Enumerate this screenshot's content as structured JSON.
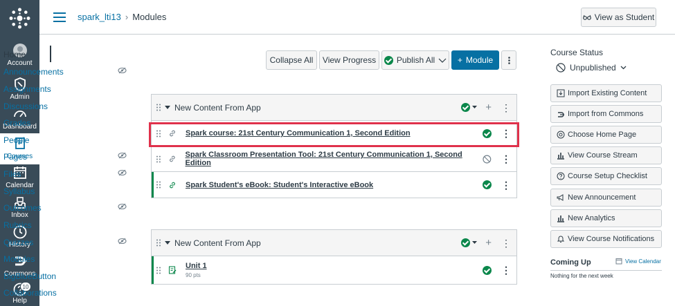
{
  "global_nav": {
    "items": [
      {
        "label": "Account",
        "icon": "account-icon"
      },
      {
        "label": "Admin",
        "icon": "admin-shield-icon"
      },
      {
        "label": "Dashboard",
        "icon": "dashboard-icon"
      },
      {
        "label": "Courses",
        "icon": "courses-book-icon"
      },
      {
        "label": "Calendar",
        "icon": "calendar-icon"
      },
      {
        "label": "Inbox",
        "icon": "inbox-icon"
      },
      {
        "label": "History",
        "icon": "history-clock-icon"
      },
      {
        "label": "Commons",
        "icon": "commons-icon"
      },
      {
        "label": "Help",
        "icon": "help-icon"
      }
    ],
    "help_badge": "10",
    "colors": {
      "bg": "#394b58",
      "active": "#0770a3"
    }
  },
  "header": {
    "course": "spark_lti13",
    "page": "Modules",
    "separator": "›",
    "view_as_student": "View as Student"
  },
  "course_nav": {
    "items": [
      {
        "label": "Home"
      },
      {
        "label": "Announcements"
      },
      {
        "label": "Assignments"
      },
      {
        "label": "Discussions"
      },
      {
        "label": "Grades"
      },
      {
        "label": "People"
      },
      {
        "label": "Pages"
      },
      {
        "label": "Files"
      },
      {
        "label": "Syllabus"
      },
      {
        "label": "Outcomes"
      },
      {
        "label": "Rubrics"
      },
      {
        "label": "Quizzes"
      },
      {
        "label": "Modules"
      },
      {
        "label": "BigBlueButton"
      },
      {
        "label": "Collaborations"
      }
    ]
  },
  "toolbar": {
    "collapse_all": "Collapse All",
    "view_progress": "View Progress",
    "publish_all": "Publish All",
    "add_module": "Module",
    "plus": "+"
  },
  "modules": [
    {
      "title": "New Content From App",
      "items": [
        {
          "title": "Spark course: 21st Century Communication 1, Second Edition",
          "status": "published"
        },
        {
          "title": "Spark Classroom Presentation Tool: 21st Century Communication 1, Second Edition",
          "status": "unpublished"
        },
        {
          "title": "Spark Student's eBook: Student's Interactive eBook",
          "status": "published"
        }
      ]
    },
    {
      "title": "New Content From App",
      "items": [
        {
          "title": "Unit 1",
          "sub": "90 pts",
          "status": "published"
        }
      ]
    }
  ],
  "sidebar": {
    "course_status_label": "Course Status",
    "status_value": "Unpublished",
    "buttons": [
      "Import Existing Content",
      "Import from Commons",
      "Choose Home Page",
      "View Course Stream",
      "Course Setup Checklist",
      "New Announcement",
      "New Analytics",
      "View Course Notifications"
    ],
    "coming_up": "Coming Up",
    "view_calendar": "View Calendar",
    "nothing_next_week": "Nothing for the next week"
  },
  "colors": {
    "link": "#0770a3",
    "published": "#0b874b",
    "highlight": "#e0314b"
  }
}
